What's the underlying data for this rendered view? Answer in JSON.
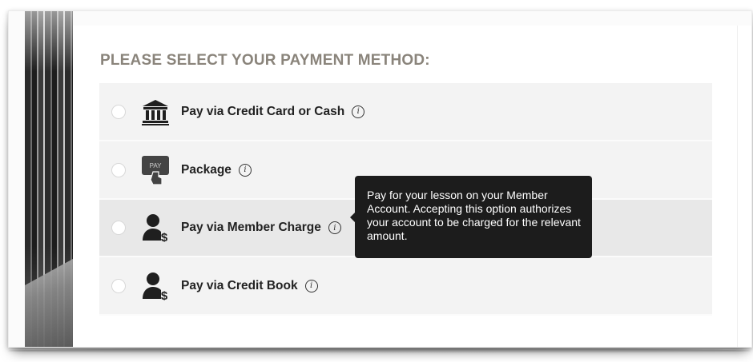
{
  "heading": "PLEASE SELECT YOUR PAYMENT METHOD:",
  "info_glyph": "i",
  "options": [
    {
      "label": "Pay via Credit Card or Cash",
      "icon": "bank-icon",
      "selected": false
    },
    {
      "label": "Package",
      "icon": "pay-touch-icon",
      "icon_text": "PAY",
      "selected": false
    },
    {
      "label": "Pay via Member Charge",
      "icon": "member-dollar-icon",
      "selected": false
    },
    {
      "label": "Pay via Credit Book",
      "icon": "member-dollar-icon",
      "selected": false
    }
  ],
  "tooltip": {
    "text": "Pay for your lesson on your Member Account. Accepting this option authorizes your account to be charged for the relevant amount."
  },
  "colors": {
    "heading": "#8a847b",
    "row_bg": "#f3f3f3",
    "row_hover_bg": "#e8e8e8",
    "tooltip_bg": "#1c1c1c"
  }
}
